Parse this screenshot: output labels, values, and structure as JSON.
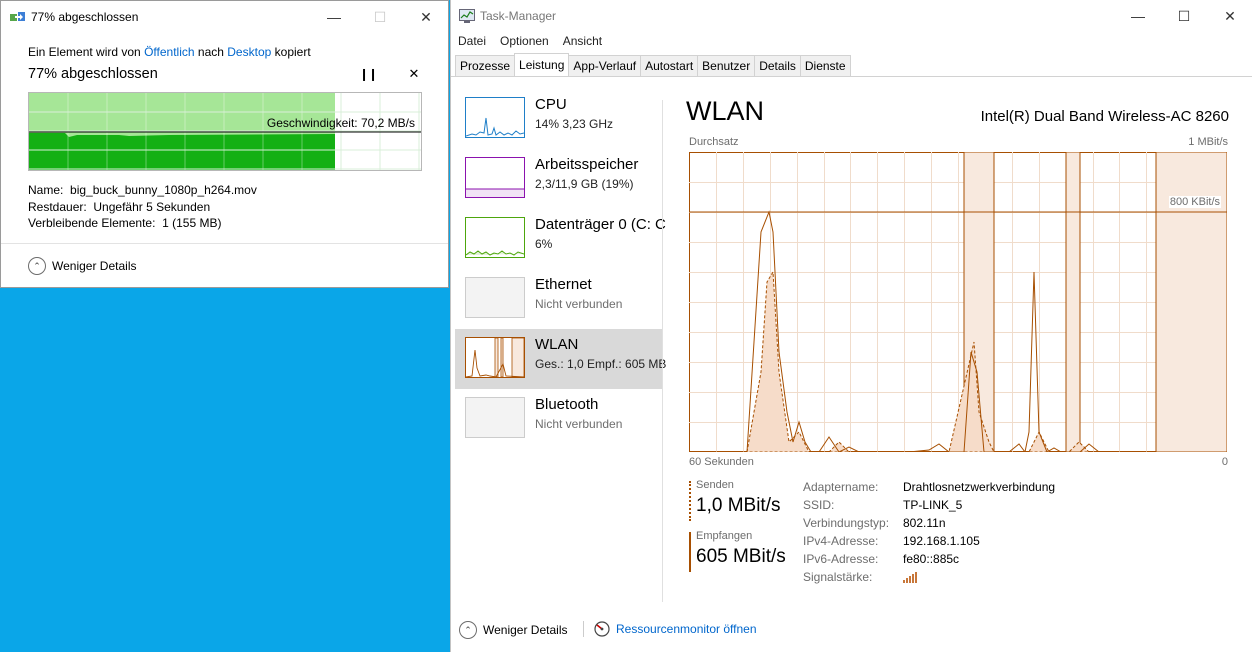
{
  "copy_dialog": {
    "title": "77% abgeschlossen",
    "line_prefix": "Ein Element wird von",
    "source": "Öffentlich",
    "line_middle": "nach",
    "destination": "Desktop",
    "line_suffix": "kopiert",
    "progress_text": "77% abgeschlossen",
    "progress_fraction": 0.77,
    "speed_text": "Geschwindigkeit: 70,2 MB/s",
    "name_label": "Name:",
    "name_value": "big_buck_bunny_1080p_h264.mov",
    "time_label": "Restdauer:",
    "time_value": "Ungefähr 5 Sekunden",
    "items_label": "Verbleibende Elemente:",
    "items_value": "1 (155 MB)",
    "fewer_details": "Weniger Details"
  },
  "task_manager": {
    "title": "Task-Manager",
    "menu": [
      "Datei",
      "Optionen",
      "Ansicht"
    ],
    "tabs": [
      "Prozesse",
      "Leistung",
      "App-Verlauf",
      "Autostart",
      "Benutzer",
      "Details",
      "Dienste"
    ],
    "active_tab": "Leistung",
    "sidebar": [
      {
        "name": "CPU",
        "sub": "14% 3,23 GHz",
        "color": "#1f7fc8"
      },
      {
        "name": "Arbeitsspeicher",
        "sub": "2,3/11,9 GB (19%)",
        "color": "#8b12ae"
      },
      {
        "name": "Datenträger 0 (C: C",
        "sub": "6%",
        "color": "#4da60c"
      },
      {
        "name": "Ethernet",
        "sub": "Nicht verbunden",
        "color": "#a74f01"
      },
      {
        "name": "WLAN",
        "sub": "Ges.: 1,0 Empf.: 605 MB",
        "color": "#a74f01"
      },
      {
        "name": "Bluetooth",
        "sub": "Nicht verbunden",
        "color": "#a74f01"
      }
    ],
    "detail": {
      "title": "WLAN",
      "adapter_model": "Intel(R) Dual Band Wireless-AC 8260",
      "chart_label_left": "Durchsatz",
      "chart_label_right": "1 MBit/s",
      "chart_mark_label": "800 KBit/s",
      "x_left": "60 Sekunden",
      "x_right": "0",
      "send_label": "Senden",
      "send_value": "1,0 MBit/s",
      "recv_label": "Empfangen",
      "recv_value": "605 MBit/s",
      "properties": [
        {
          "key": "Adaptername:",
          "value": "Drahtlosnetzwerkverbindung"
        },
        {
          "key": "SSID:",
          "value": "TP-LINK_5"
        },
        {
          "key": "Verbindungstyp:",
          "value": "802.11n"
        },
        {
          "key": "IPv4-Adresse:",
          "value": "192.168.1.105"
        },
        {
          "key": "IPv6-Adresse:",
          "value": "fe80::885c"
        },
        {
          "key": "Signalstärke:",
          "value": ""
        }
      ]
    },
    "fewer_details": "Weniger Details",
    "resource_monitor": "Ressourcenmonitor öffnen"
  },
  "colors": {
    "desktop": "#0aa6e8",
    "copy_green": "#14b014",
    "copy_light_green": "#a6e697",
    "network": "#a74f01",
    "link": "#0066cc"
  }
}
